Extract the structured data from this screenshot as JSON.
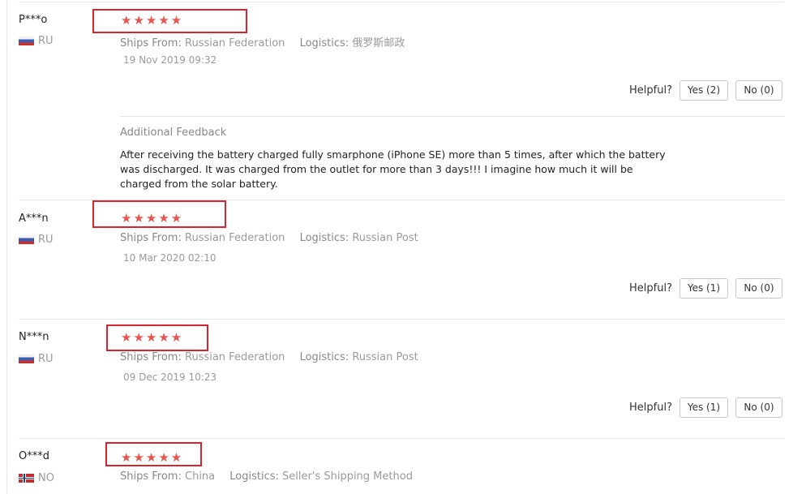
{
  "labels": {
    "ships_from": "Ships From:",
    "logistics": "Logistics:",
    "helpful": "Helpful?",
    "additional_feedback": "Additional Feedback"
  },
  "reviews": [
    {
      "user": "P***o",
      "country_code": "RU",
      "flag": "russia-flag",
      "rating": 5,
      "stars": "★★★★★",
      "ships_from": "Russian Federation",
      "logistics": "俄罗斯邮政",
      "date": "19 Nov 2019 09:32",
      "yes_label": "Yes (2)",
      "no_label": "No (0)",
      "additional_feedback": "After receiving the battery charged fully smarphone (iPhone SE) more than 5 times, after which the battery was discharged. It was charged from the outlet for more than 3 days!!! I imagine how much it will be charged from the solar battery."
    },
    {
      "user": "A***n",
      "country_code": "RU",
      "flag": "russia-flag",
      "rating": 5,
      "stars": "★★★★★",
      "ships_from": "Russian Federation",
      "logistics": "Russian Post",
      "date": "10 Mar 2020 02:10",
      "yes_label": "Yes (1)",
      "no_label": "No (0)"
    },
    {
      "user": "N***n",
      "country_code": "RU",
      "flag": "russia-flag",
      "rating": 5,
      "stars": "★★★★★",
      "ships_from": "Russian Federation",
      "logistics": "Russian Post",
      "date": "09 Dec 2019 10:23",
      "yes_label": "Yes (1)",
      "no_label": "No (0)"
    },
    {
      "user": "O***d",
      "country_code": "NO",
      "flag": "norway-flag",
      "rating": 5,
      "stars": "★★★★★",
      "ships_from": "China",
      "logistics": "Seller's Shipping Method"
    }
  ],
  "colors": {
    "star": "#e8544e",
    "highlight_box": "#d9232d",
    "muted_text": "#9a9a9a",
    "divider": "#e6e6e6"
  }
}
